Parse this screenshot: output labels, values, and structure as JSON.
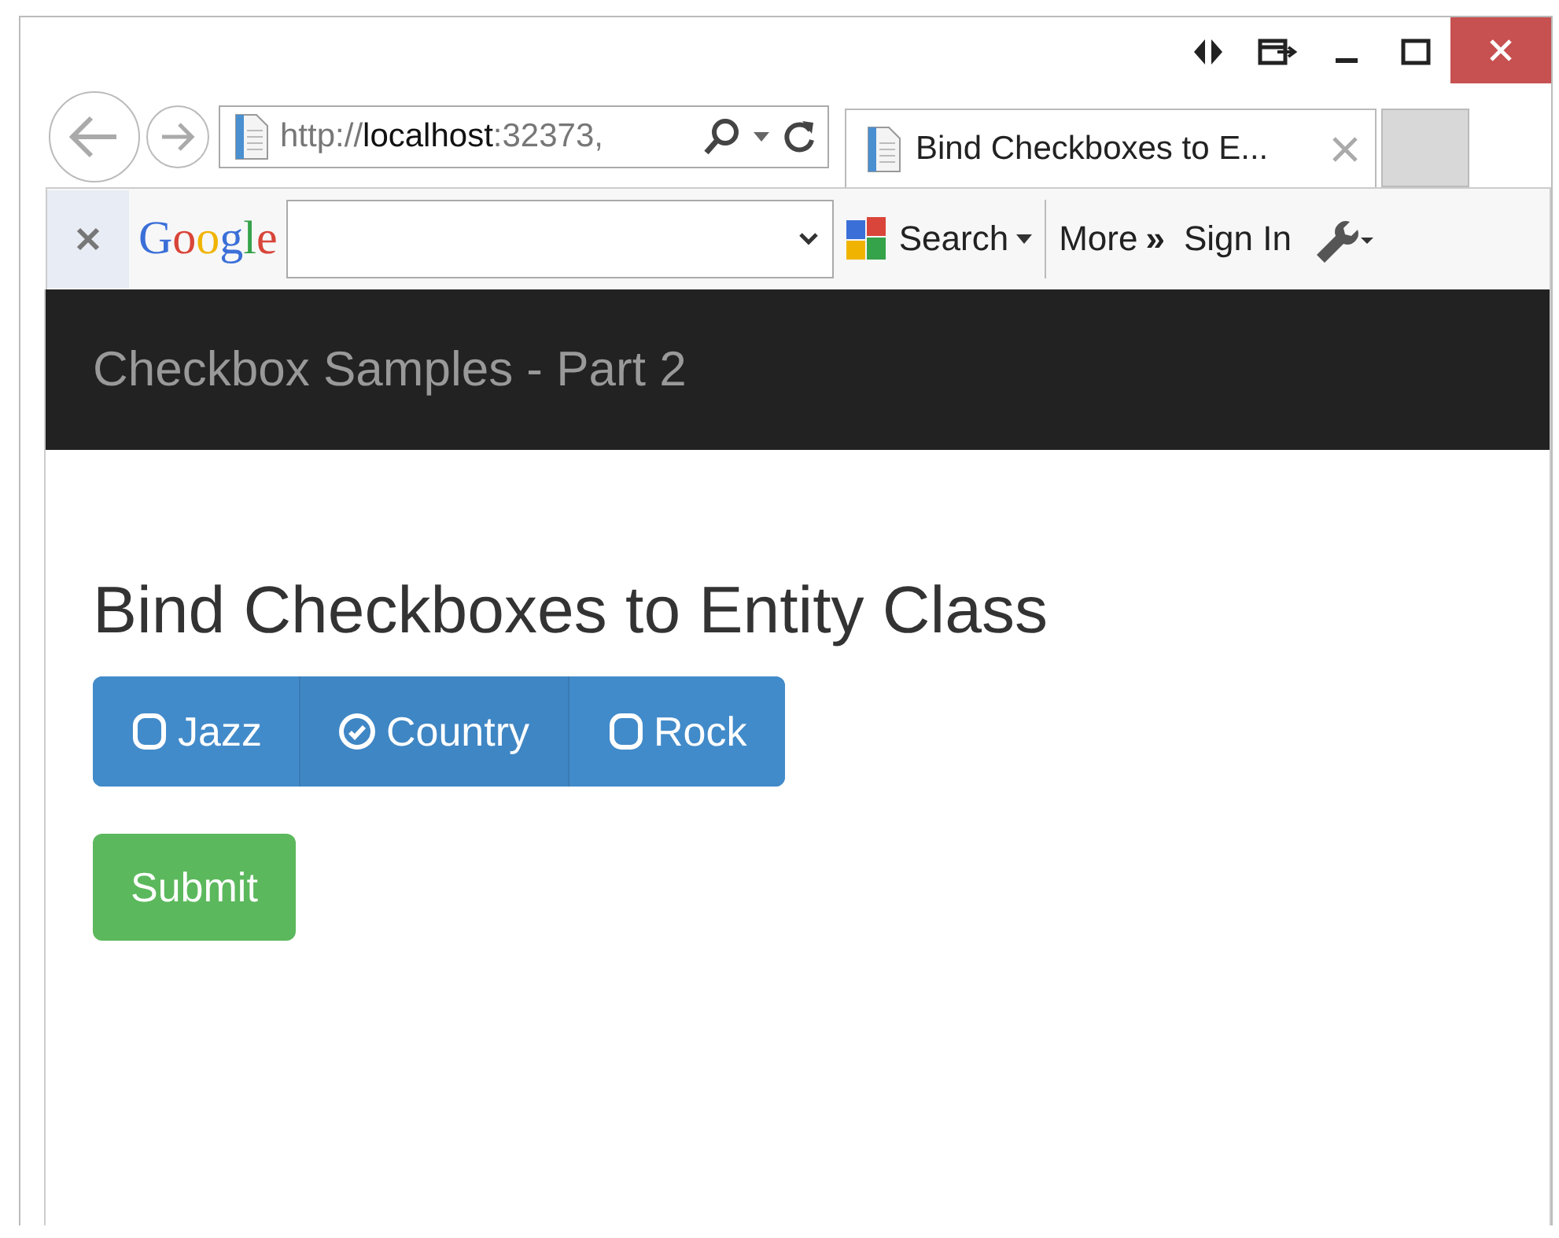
{
  "browser": {
    "address": "http://**localhost**:32373,",
    "tab": {
      "title": "Bind Checkboxes to E...",
      "selected": true
    }
  },
  "google_toolbar": {
    "logo": "Google",
    "search_label": "Search",
    "more_label": "More",
    "more_glyph": "»",
    "sign_in": "Sign In"
  },
  "navbar": {
    "brand": "Checkbox Samples - Part 2"
  },
  "page": {
    "heading": "Bind Checkboxes to Entity Class",
    "options": [
      {
        "label": "Jazz",
        "checked": false
      },
      {
        "label": "Country",
        "checked": true
      },
      {
        "label": "Rock",
        "checked": false
      }
    ],
    "submit": "Submit"
  }
}
